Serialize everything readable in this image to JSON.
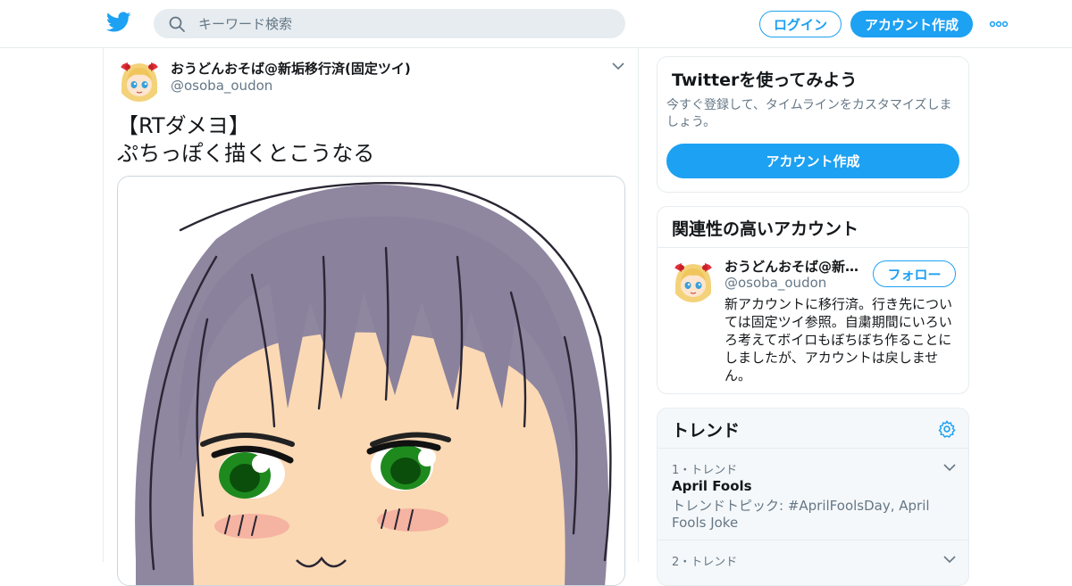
{
  "header": {
    "search_placeholder": "キーワード検索",
    "login_label": "ログイン",
    "signup_label": "アカウント作成",
    "accent_color": "#1da1f2"
  },
  "tweet": {
    "author_name": "おうどんおそば@新垢移行済(固定ツイ)",
    "author_handle": "@osoba_oudon",
    "text": "【RTダメヨ】\nぷちっぽく描くとこうなる"
  },
  "sidebar": {
    "join": {
      "title": "Twitterを使ってみよう",
      "description": "今すぐ登録して、タイムラインをカスタマイズしましょう。",
      "button_label": "アカウント作成"
    },
    "related": {
      "title": "関連性の高いアカウント",
      "account": {
        "name": "おうどんおそば@新垢移行済(固定ツイ)",
        "handle": "@osoba_oudon",
        "follow_label": "フォロー",
        "bio": "新アカウントに移行済。行き先については固定ツイ参照。自粛期間にいろいろ考えてボイロもぼちぼち作ることにしましたが、アカウントは戻しません。"
      }
    },
    "trends": {
      "title": "トレンド",
      "items": [
        {
          "rank": "1・トレンド",
          "name": "April Fools",
          "meta": "トレンドトピック: #AprilFoolsDay, April Fools Joke"
        },
        {
          "rank": "2・トレンド",
          "name": "",
          "meta": ""
        }
      ]
    }
  }
}
